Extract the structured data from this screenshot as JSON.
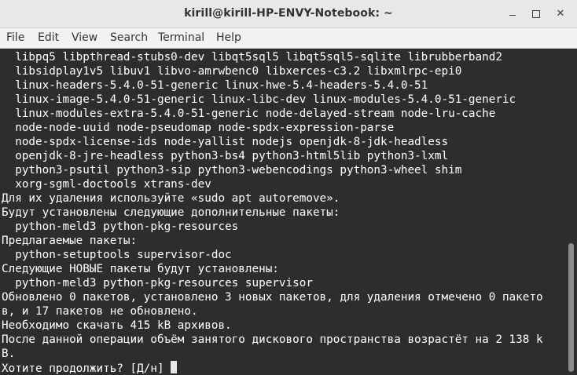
{
  "window": {
    "title": "kirill@kirill-HP-ENVY-Notebook: ~",
    "minimize_icon": "minimize-icon",
    "maximize_icon": "maximize-icon",
    "close_icon": "close-icon",
    "close_glyph": "✕"
  },
  "menubar": {
    "items": [
      {
        "label": "File"
      },
      {
        "label": "Edit"
      },
      {
        "label": "View"
      },
      {
        "label": "Search"
      },
      {
        "label": "Terminal"
      },
      {
        "label": "Help"
      }
    ]
  },
  "terminal": {
    "lines": [
      "  libpq5 libpthread-stubs0-dev libqt5sql5 libqt5sql5-sqlite librubberband2",
      "  libsidplay1v5 libuv1 libvo-amrwbenc0 libxerces-c3.2 libxmlrpc-epi0",
      "  linux-headers-5.4.0-51-generic linux-hwe-5.4-headers-5.4.0-51",
      "  linux-image-5.4.0-51-generic linux-libc-dev linux-modules-5.4.0-51-generic",
      "  linux-modules-extra-5.4.0-51-generic node-delayed-stream node-lru-cache",
      "  node-node-uuid node-pseudomap node-spdx-expression-parse",
      "  node-spdx-license-ids node-yallist nodejs openjdk-8-jdk-headless",
      "  openjdk-8-jre-headless python3-bs4 python3-html5lib python3-lxml",
      "  python3-psutil python3-sip python3-webencodings python3-wheel shim",
      "  xorg-sgml-doctools xtrans-dev",
      "Для их удаления используйте «sudo apt autoremove».",
      "Будут установлены следующие дополнительные пакеты:",
      "  python-meld3 python-pkg-resources",
      "Предлагаемые пакеты:",
      "  python-setuptools supervisor-doc",
      "Следующие НОВЫЕ пакеты будут установлены:",
      "  python-meld3 python-pkg-resources supervisor",
      "Обновлено 0 пакетов, установлено 3 новых пакетов, для удаления отмечено 0 пакето",
      "в, и 17 пакетов не обновлено.",
      "Необходимо скачать 415 kB архивов.",
      "После данной операции объём занятого дискового пространства возрастёт на 2 138 k",
      "B.",
      "Хотите продолжить? [Д/н] "
    ]
  },
  "colors": {
    "terminal_bg": "#2d2d2d",
    "terminal_fg": "#ffffff",
    "titlebar_bg": "#e8e8e7",
    "menubar_bg": "#f2f2f2"
  }
}
